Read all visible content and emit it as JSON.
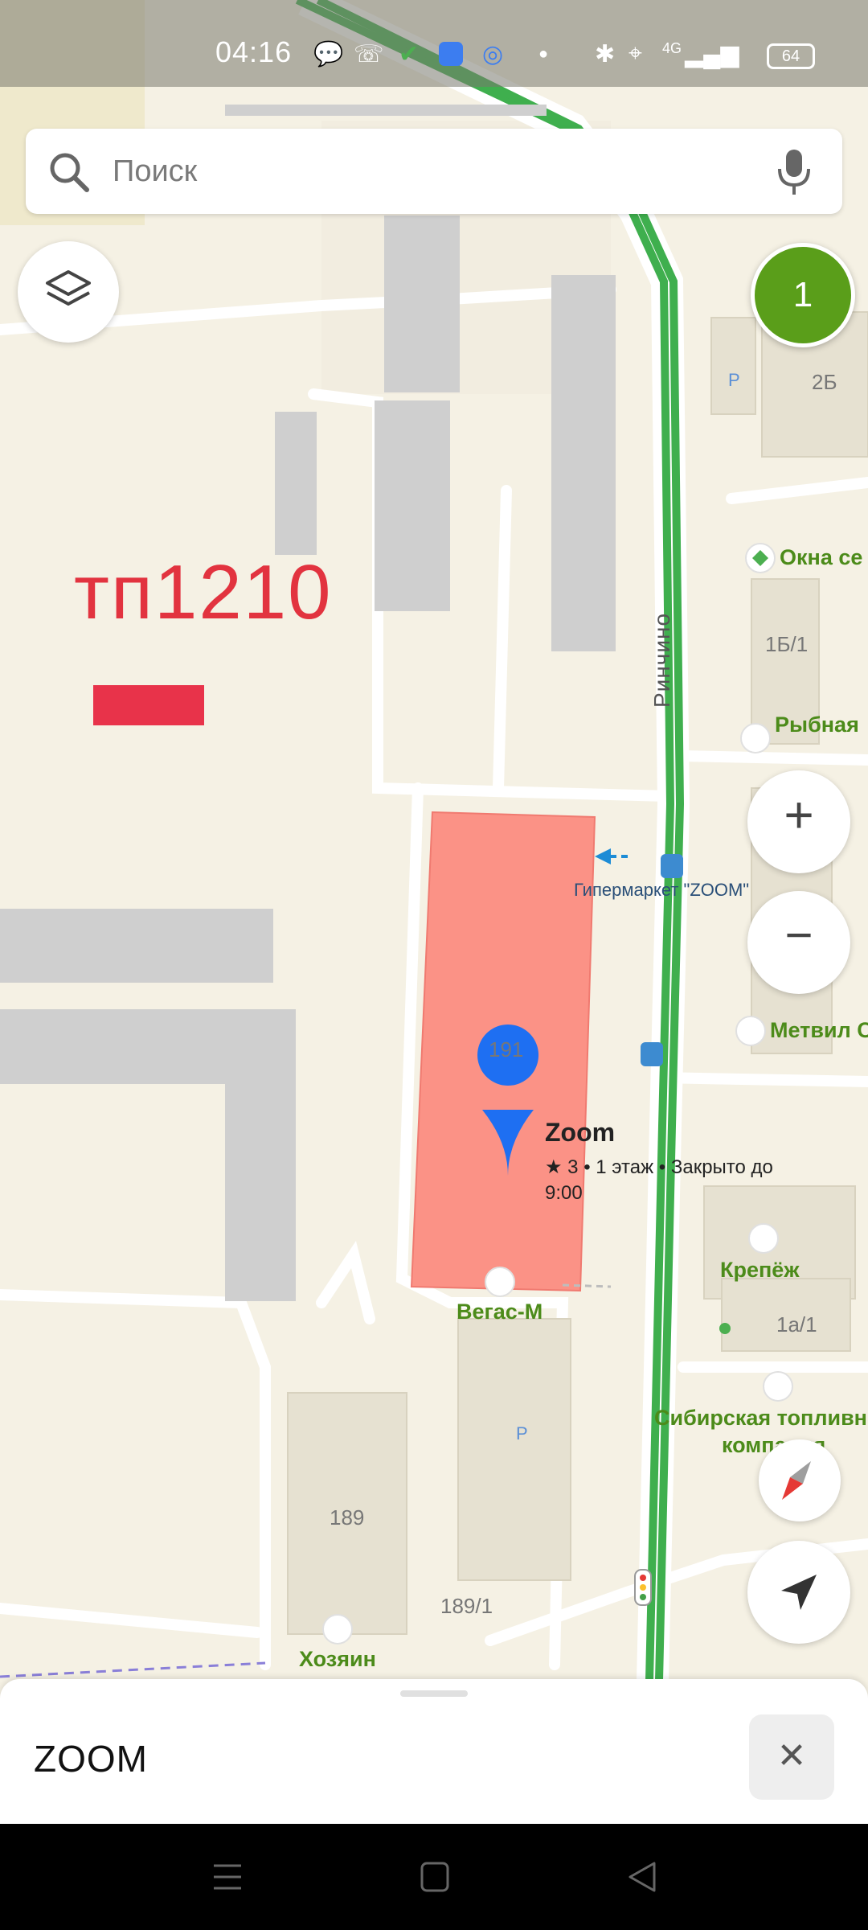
{
  "status_bar": {
    "time": "04:16",
    "network": "4G",
    "battery": "64",
    "icons": [
      "message-icon",
      "phone-icon",
      "check-icon",
      "app-icon",
      "search-app-icon",
      "dot-icon",
      "bluetooth-icon",
      "location-icon",
      "signal-icon",
      "battery-icon"
    ]
  },
  "search": {
    "placeholder": "Поиск"
  },
  "map": {
    "overlay_label": "тп1210",
    "notifications_count": "1",
    "street_name": "Ринчино",
    "transit_stop": "Гипермаркет \"ZOOM\"",
    "buildings": [
      "2Б",
      "1Б/1",
      "191",
      "1а/1",
      "189",
      "189/1"
    ],
    "parking_label": "P",
    "pois": [
      "Окна се",
      "Рыбная",
      "Метвил С",
      "Крепёж",
      "Вегас-М",
      "Сибирская топливн",
      "компания",
      "Хозяин"
    ],
    "selected": {
      "name": "Zoom",
      "details": "★ 3 • 1 этаж • Закрыто до 9:00"
    },
    "colors": {
      "selected_building": "#fb9286",
      "route": "#4caf50",
      "poi_text": "#4c8b1a",
      "overlay": "#e2333f",
      "badge": "#5a9e1a"
    }
  },
  "controls": {
    "zoom_in": "+",
    "zoom_out": "−",
    "layers_icon": "layers-icon",
    "compass_icon": "compass-icon",
    "locate_icon": "navigation-arrow-icon"
  },
  "bottom_sheet": {
    "title": "ZOOM",
    "close": "✕"
  }
}
